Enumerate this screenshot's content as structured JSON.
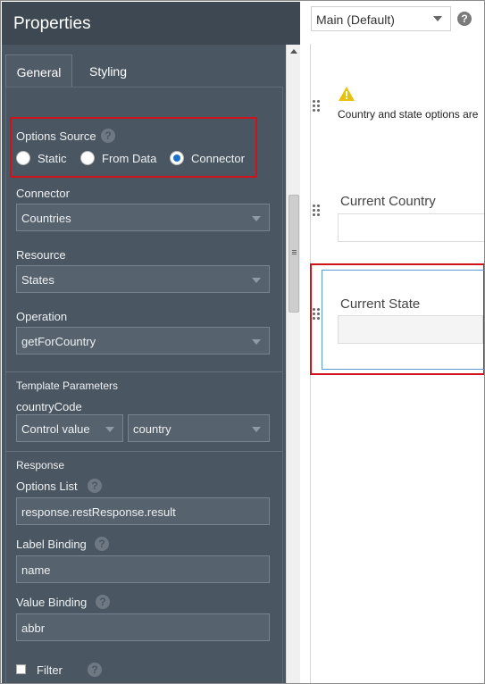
{
  "panel": {
    "title": "Properties",
    "tabs": [
      {
        "label": "General"
      },
      {
        "label": "Styling"
      }
    ]
  },
  "options_source": {
    "label": "Options Source",
    "options": [
      {
        "label": "Static",
        "checked": false
      },
      {
        "label": "From Data",
        "checked": false
      },
      {
        "label": "Connector",
        "checked": true
      }
    ]
  },
  "connector": {
    "label": "Connector",
    "value": "Countries"
  },
  "resource": {
    "label": "Resource",
    "value": "States"
  },
  "operation": {
    "label": "Operation",
    "value": "getForCountry"
  },
  "template_parameters": {
    "label": "Template Parameters",
    "param_name": "countryCode",
    "type_value": "Control value",
    "control_value": "country"
  },
  "response": {
    "label": "Response",
    "options_list": {
      "label": "Options List",
      "value": "response.restResponse.result"
    },
    "label_binding": {
      "label": "Label Binding",
      "value": "name"
    },
    "value_binding": {
      "label": "Value Binding",
      "value": "abbr"
    },
    "filter": {
      "label": "Filter",
      "checked": false
    }
  },
  "canvas": {
    "mode": "Main (Default)",
    "warning_text": "Country and state options are",
    "fields": [
      {
        "label": "Current Country"
      },
      {
        "label": "Current State"
      }
    ]
  },
  "colors": {
    "accent": "#1a73c9",
    "highlight": "#d0121a",
    "panel": "#4a5661"
  }
}
